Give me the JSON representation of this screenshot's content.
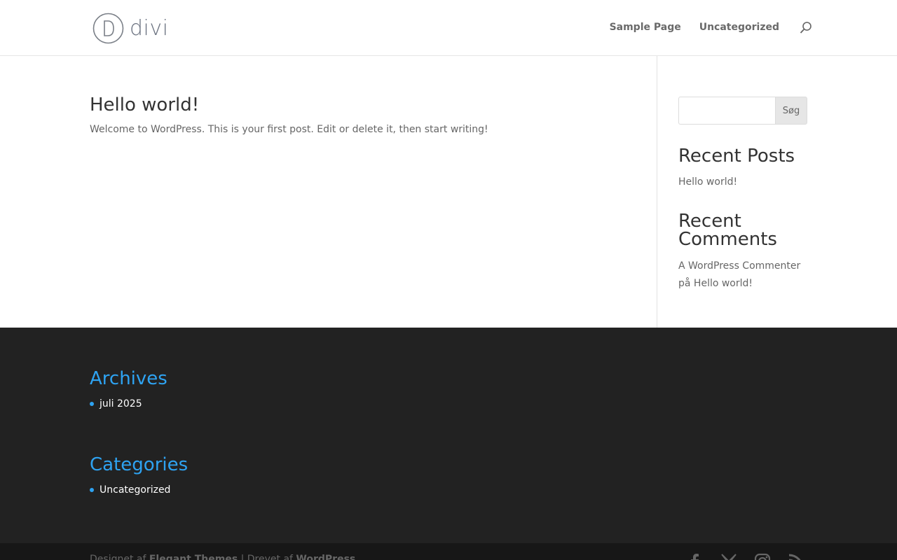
{
  "header": {
    "logo_text": "divi",
    "nav": [
      {
        "label": "Sample Page"
      },
      {
        "label": "Uncategorized"
      }
    ]
  },
  "main": {
    "post": {
      "title": "Hello world!",
      "excerpt": "Welcome to WordPress. This is your first post. Edit or delete it, then start writing!"
    }
  },
  "sidebar": {
    "search": {
      "placeholder": "",
      "button_label": "Søg"
    },
    "recent_posts": {
      "title": "Recent Posts",
      "items": [
        {
          "label": "Hello world!"
        }
      ]
    },
    "recent_comments": {
      "title": "Recent Comments",
      "author": "A WordPress Commenter",
      "connector": "på",
      "post": "Hello world!"
    }
  },
  "footer": {
    "archives": {
      "title": "Archives",
      "items": [
        {
          "label": "juli 2025"
        }
      ]
    },
    "categories": {
      "title": "Categories",
      "items": [
        {
          "label": "Uncategorized"
        }
      ]
    },
    "credits": {
      "designed_prefix": "Designet af",
      "elegant": "Elegant Themes",
      "separator": "|",
      "drevet_prefix": "Drevet af",
      "wordpress": "WordPress"
    },
    "social_icons": [
      "facebook-icon",
      "x-icon",
      "instagram-icon",
      "rss-icon"
    ]
  },
  "colors": {
    "accent": "#2ea3f2",
    "footer_bg": "#222222",
    "bottom_bar_bg": "#171717"
  }
}
